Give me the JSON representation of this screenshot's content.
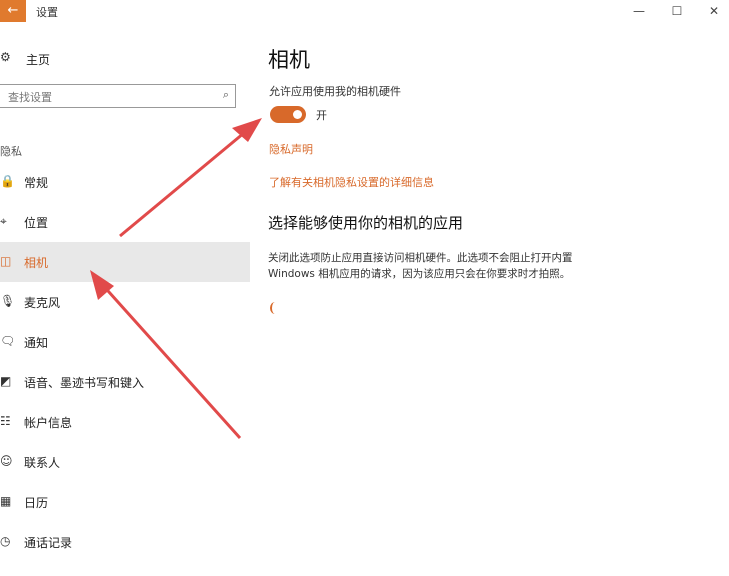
{
  "window": {
    "title": "设置",
    "back_icon": "←",
    "minimize_icon": "—",
    "maximize_icon": "☐",
    "close_icon": "✕"
  },
  "sidebar": {
    "home": {
      "icon": "⚙",
      "label": "主页"
    },
    "search_placeholder": "查找设置",
    "search_icon": "⌕",
    "section_label": "隐私",
    "items": [
      {
        "icon": "🔒",
        "label": "常规"
      },
      {
        "icon": "⌖",
        "label": "位置"
      },
      {
        "icon": "◫",
        "label": "相机",
        "selected": true
      },
      {
        "icon": "🎙",
        "label": "麦克风"
      },
      {
        "icon": "🗨",
        "label": "通知"
      },
      {
        "icon": "◩",
        "label": "语音、墨迹书写和键入"
      },
      {
        "icon": "☷",
        "label": "帐户信息"
      },
      {
        "icon": "☺",
        "label": "联系人"
      },
      {
        "icon": "▦",
        "label": "日历"
      },
      {
        "icon": "◷",
        "label": "通话记录"
      }
    ]
  },
  "main": {
    "title": "相机",
    "toggle_caption": "允许应用使用我的相机硬件",
    "toggle_state": "开",
    "privacy_link": "隐私声明",
    "learn_more_link": "了解有关相机隐私设置的详细信息",
    "section_title": "选择能够使用你的相机的应用",
    "description_lines": [
      "关闭此选项防止应用直接访问相机硬件。此选项不会阻止打开内置",
      "Windows 相机应用的请求，因为该应用只会在你要求时才拍照。"
    ]
  },
  "colors": {
    "accent": "#d8692a",
    "arrow": "#e14a4a",
    "selected_bg": "#e8e8e8"
  }
}
